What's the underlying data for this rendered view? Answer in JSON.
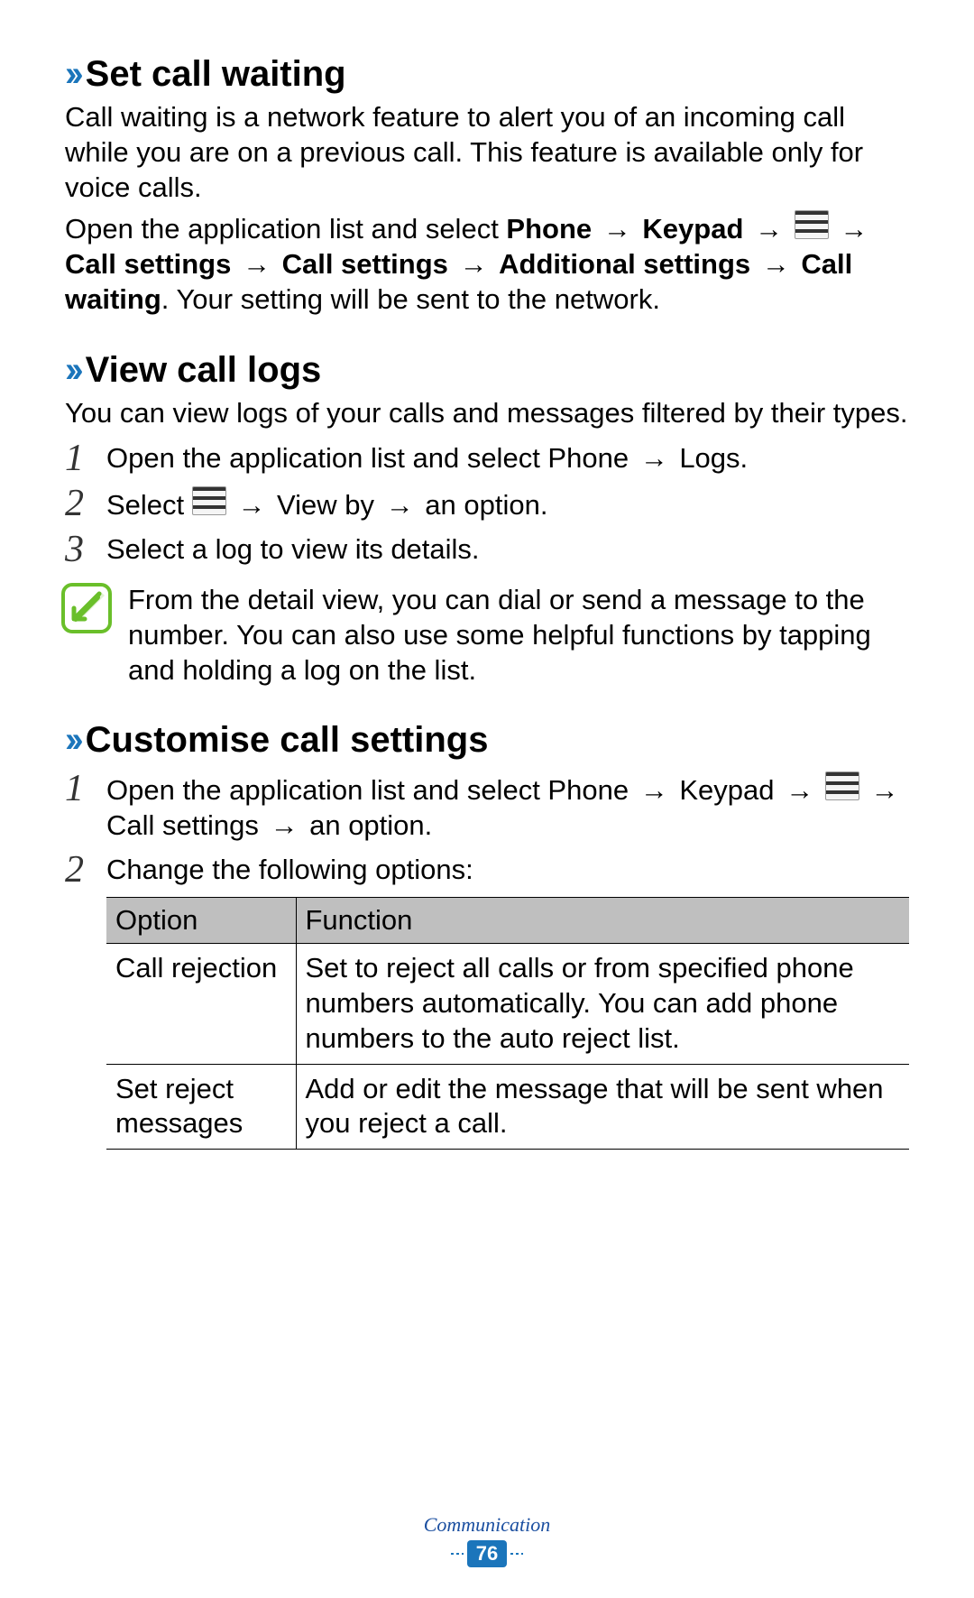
{
  "sections": [
    {
      "heading": "Set call waiting",
      "intro": "Call waiting is a network feature to alert you of an incoming call while you are on a previous call. This feature is available only for voice calls.",
      "open_prefix": "Open the application list and select ",
      "path1_a": "Phone",
      "path1_b": "Keypad",
      "path1_c": "Call settings",
      "path1_d": "Call settings",
      "path1_e": "Additional settings",
      "path1_f": "Call waiting",
      "outro": ". Your setting will be sent to the network."
    },
    {
      "heading": "View call logs",
      "intro": "You can view logs of your calls and messages filtered by their types.",
      "steps": [
        {
          "pre": "Open the application list and select ",
          "bold_a": "Phone",
          "bold_b": "Logs",
          "post": "."
        },
        {
          "pre": "Select ",
          "mid": "View by",
          "post": " an option."
        },
        {
          "plain": "Select a log to view its details."
        }
      ],
      "note": "From the detail view, you can dial or send a message to the number. You can also use some helpful functions by tapping and holding a log on the list."
    },
    {
      "heading": "Customise call settings",
      "steps": [
        {
          "pre": "Open the application list and select ",
          "bold_a": "Phone",
          "bold_b": "Keypad",
          "bold_c": "Call settings",
          "post": " an option."
        },
        {
          "plain": "Change the following options:"
        }
      ],
      "table": {
        "headers": [
          "Option",
          "Function"
        ],
        "rows": [
          {
            "option": "Call rejection",
            "function": "Set to reject all calls or from specified phone numbers automatically. You can add phone numbers to the auto reject list."
          },
          {
            "option": "Set reject messages",
            "function": "Add or edit the message that will be sent when you reject a call."
          }
        ]
      }
    }
  ],
  "footer": {
    "section": "Communication",
    "page": "76"
  },
  "labels": {
    "arrow": "→",
    "select": "Select "
  }
}
